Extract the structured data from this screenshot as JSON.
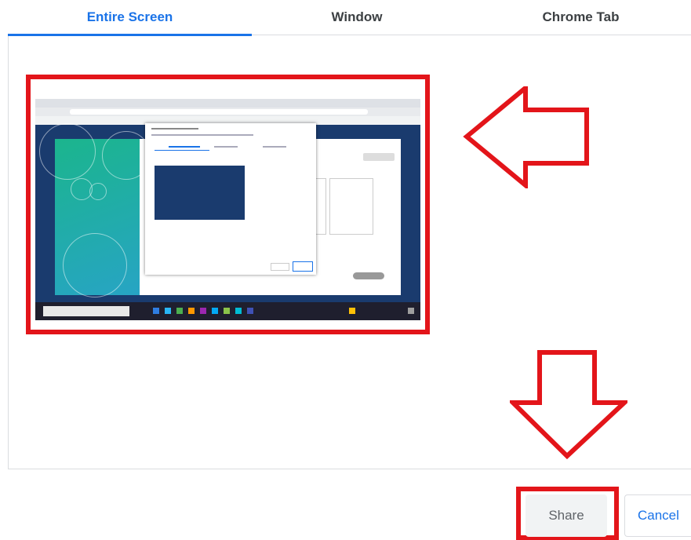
{
  "tabs": [
    {
      "label": "Entire Screen",
      "active": true
    },
    {
      "label": "Window",
      "active": false
    },
    {
      "label": "Chrome Tab",
      "active": false
    }
  ],
  "buttons": {
    "share_label": "Share",
    "cancel_label": "Cancel"
  },
  "colors": {
    "accent": "#1a73e8",
    "annotation_red": "#e3151a",
    "tab_text": "#3c4043"
  },
  "icons": [
    "screen-thumbnail",
    "left-arrow-annotation",
    "down-arrow-annotation"
  ]
}
